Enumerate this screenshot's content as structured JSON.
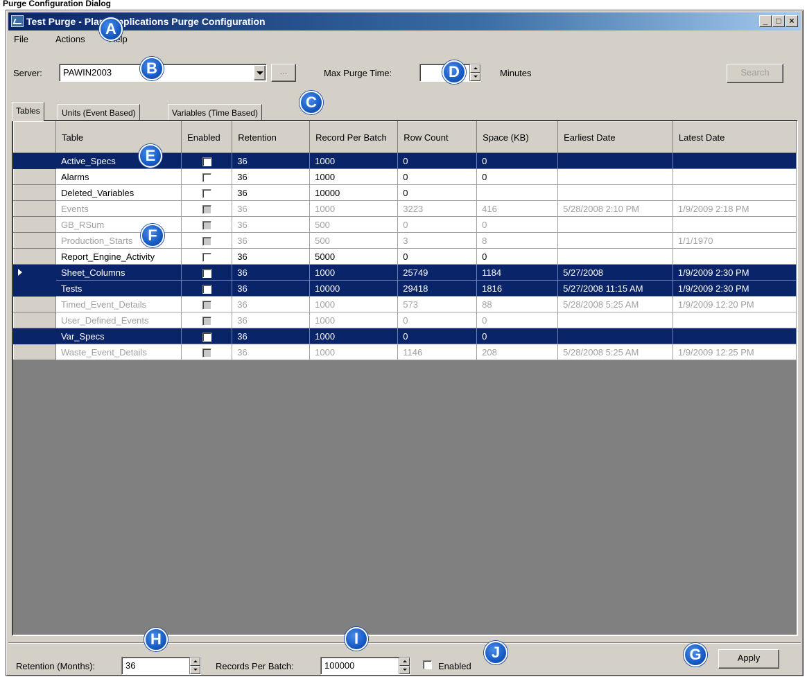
{
  "caption": "Purge Configuration Dialog",
  "window": {
    "title": "Test Purge - Plant Applications Purge Configuration",
    "controls": {
      "minimize": "_",
      "maximize": "□",
      "close": "×"
    }
  },
  "menu": {
    "items": [
      {
        "label": "File"
      },
      {
        "label": "Actions"
      },
      {
        "label": "Help"
      }
    ]
  },
  "toolbar": {
    "server_label": "Server:",
    "server_value": "PAWIN2003",
    "browse_label": "...",
    "max_purge_label": "Max Purge Time:",
    "max_purge_value": "",
    "minutes_label": "Minutes",
    "search_label": "Search"
  },
  "tabs": [
    {
      "label": "Tables",
      "active": true
    },
    {
      "label": "Units (Event Based)",
      "active": false
    },
    {
      "label": "Variables (Time Based)",
      "active": false
    }
  ],
  "grid": {
    "columns": [
      "Table",
      "Enabled",
      "Retention",
      "Record Per Batch",
      "Row Count",
      "Space (KB)",
      "Earliest Date",
      "Latest Date"
    ],
    "rows": [
      {
        "table": "Active_Specs",
        "retention": "36",
        "batch": "1000",
        "rows": "0",
        "space": "0",
        "earliest": "",
        "latest": "",
        "state": "selected"
      },
      {
        "table": "Alarms",
        "retention": "36",
        "batch": "1000",
        "rows": "0",
        "space": "0",
        "earliest": "",
        "latest": "",
        "state": "normal"
      },
      {
        "table": "Deleted_Variables",
        "retention": "36",
        "batch": "10000",
        "rows": "0",
        "space": "",
        "earliest": "",
        "latest": "",
        "state": "normal"
      },
      {
        "table": "Events",
        "retention": "36",
        "batch": "1000",
        "rows": "3223",
        "space": "416",
        "earliest": "5/28/2008 2:10 PM",
        "latest": "1/9/2009 2:18 PM",
        "state": "disabled"
      },
      {
        "table": "GB_RSum",
        "retention": "36",
        "batch": "500",
        "rows": "0",
        "space": "0",
        "earliest": "",
        "latest": "",
        "state": "disabled"
      },
      {
        "table": "Production_Starts",
        "retention": "36",
        "batch": "500",
        "rows": "3",
        "space": "8",
        "earliest": "",
        "latest": "1/1/1970",
        "state": "disabled"
      },
      {
        "table": "Report_Engine_Activity",
        "retention": "36",
        "batch": "5000",
        "rows": "0",
        "space": "0",
        "earliest": "",
        "latest": "",
        "state": "normal"
      },
      {
        "table": "Sheet_Columns",
        "retention": "36",
        "batch": "1000",
        "rows": "25749",
        "space": "1184",
        "earliest": "5/27/2008",
        "latest": "1/9/2009 2:30 PM",
        "state": "selected",
        "current": true
      },
      {
        "table": "Tests",
        "retention": "36",
        "batch": "10000",
        "rows": "29418",
        "space": "1816",
        "earliest": "5/27/2008 11:15 AM",
        "latest": "1/9/2009 2:30 PM",
        "state": "selected"
      },
      {
        "table": "Timed_Event_Details",
        "retention": "36",
        "batch": "1000",
        "rows": "573",
        "space": "88",
        "earliest": "5/28/2008 5:25 AM",
        "latest": "1/9/2009 12:20 PM",
        "state": "disabled"
      },
      {
        "table": "User_Defined_Events",
        "retention": "36",
        "batch": "1000",
        "rows": "0",
        "space": "0",
        "earliest": "",
        "latest": "",
        "state": "disabled"
      },
      {
        "table": "Var_Specs",
        "retention": "36",
        "batch": "1000",
        "rows": "0",
        "space": "0",
        "earliest": "",
        "latest": "",
        "state": "selected"
      },
      {
        "table": "Waste_Event_Details",
        "retention": "36",
        "batch": "1000",
        "rows": "1146",
        "space": "208",
        "earliest": "5/28/2008 5:25 AM",
        "latest": "1/9/2009 12:25 PM",
        "state": "disabled"
      }
    ]
  },
  "footer": {
    "retention_label": "Retention (Months):",
    "retention_value": "36",
    "batch_label": "Records Per Batch:",
    "batch_value": "100000",
    "enabled_label": "Enabled",
    "apply_label": "Apply"
  },
  "callouts": [
    "A",
    "B",
    "C",
    "D",
    "E",
    "F",
    "G",
    "H",
    "I",
    "J"
  ],
  "colors": {
    "selection": "#0a246a",
    "face": "#d4d0c8",
    "callout": "#1a5fc8"
  }
}
